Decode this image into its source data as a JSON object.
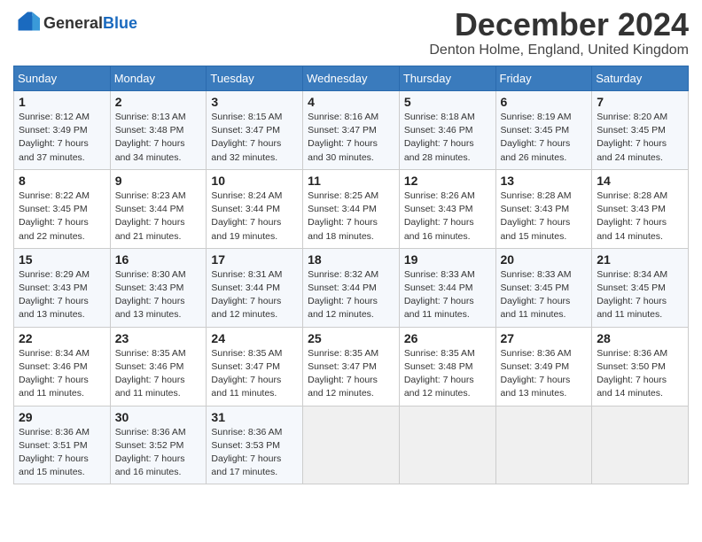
{
  "header": {
    "logo_line1": "General",
    "logo_line2": "Blue",
    "month_title": "December 2024",
    "location": "Denton Holme, England, United Kingdom"
  },
  "days_of_week": [
    "Sunday",
    "Monday",
    "Tuesday",
    "Wednesday",
    "Thursday",
    "Friday",
    "Saturday"
  ],
  "weeks": [
    [
      {
        "day": "1",
        "sunrise": "8:12 AM",
        "sunset": "3:49 PM",
        "daylight": "7 hours and 37 minutes."
      },
      {
        "day": "2",
        "sunrise": "8:13 AM",
        "sunset": "3:48 PM",
        "daylight": "7 hours and 34 minutes."
      },
      {
        "day": "3",
        "sunrise": "8:15 AM",
        "sunset": "3:47 PM",
        "daylight": "7 hours and 32 minutes."
      },
      {
        "day": "4",
        "sunrise": "8:16 AM",
        "sunset": "3:47 PM",
        "daylight": "7 hours and 30 minutes."
      },
      {
        "day": "5",
        "sunrise": "8:18 AM",
        "sunset": "3:46 PM",
        "daylight": "7 hours and 28 minutes."
      },
      {
        "day": "6",
        "sunrise": "8:19 AM",
        "sunset": "3:45 PM",
        "daylight": "7 hours and 26 minutes."
      },
      {
        "day": "7",
        "sunrise": "8:20 AM",
        "sunset": "3:45 PM",
        "daylight": "7 hours and 24 minutes."
      }
    ],
    [
      {
        "day": "8",
        "sunrise": "8:22 AM",
        "sunset": "3:45 PM",
        "daylight": "7 hours and 22 minutes."
      },
      {
        "day": "9",
        "sunrise": "8:23 AM",
        "sunset": "3:44 PM",
        "daylight": "7 hours and 21 minutes."
      },
      {
        "day": "10",
        "sunrise": "8:24 AM",
        "sunset": "3:44 PM",
        "daylight": "7 hours and 19 minutes."
      },
      {
        "day": "11",
        "sunrise": "8:25 AM",
        "sunset": "3:44 PM",
        "daylight": "7 hours and 18 minutes."
      },
      {
        "day": "12",
        "sunrise": "8:26 AM",
        "sunset": "3:43 PM",
        "daylight": "7 hours and 16 minutes."
      },
      {
        "day": "13",
        "sunrise": "8:28 AM",
        "sunset": "3:43 PM",
        "daylight": "7 hours and 15 minutes."
      },
      {
        "day": "14",
        "sunrise": "8:28 AM",
        "sunset": "3:43 PM",
        "daylight": "7 hours and 14 minutes."
      }
    ],
    [
      {
        "day": "15",
        "sunrise": "8:29 AM",
        "sunset": "3:43 PM",
        "daylight": "7 hours and 13 minutes."
      },
      {
        "day": "16",
        "sunrise": "8:30 AM",
        "sunset": "3:43 PM",
        "daylight": "7 hours and 13 minutes."
      },
      {
        "day": "17",
        "sunrise": "8:31 AM",
        "sunset": "3:44 PM",
        "daylight": "7 hours and 12 minutes."
      },
      {
        "day": "18",
        "sunrise": "8:32 AM",
        "sunset": "3:44 PM",
        "daylight": "7 hours and 12 minutes."
      },
      {
        "day": "19",
        "sunrise": "8:33 AM",
        "sunset": "3:44 PM",
        "daylight": "7 hours and 11 minutes."
      },
      {
        "day": "20",
        "sunrise": "8:33 AM",
        "sunset": "3:45 PM",
        "daylight": "7 hours and 11 minutes."
      },
      {
        "day": "21",
        "sunrise": "8:34 AM",
        "sunset": "3:45 PM",
        "daylight": "7 hours and 11 minutes."
      }
    ],
    [
      {
        "day": "22",
        "sunrise": "8:34 AM",
        "sunset": "3:46 PM",
        "daylight": "7 hours and 11 minutes."
      },
      {
        "day": "23",
        "sunrise": "8:35 AM",
        "sunset": "3:46 PM",
        "daylight": "7 hours and 11 minutes."
      },
      {
        "day": "24",
        "sunrise": "8:35 AM",
        "sunset": "3:47 PM",
        "daylight": "7 hours and 11 minutes."
      },
      {
        "day": "25",
        "sunrise": "8:35 AM",
        "sunset": "3:47 PM",
        "daylight": "7 hours and 12 minutes."
      },
      {
        "day": "26",
        "sunrise": "8:35 AM",
        "sunset": "3:48 PM",
        "daylight": "7 hours and 12 minutes."
      },
      {
        "day": "27",
        "sunrise": "8:36 AM",
        "sunset": "3:49 PM",
        "daylight": "7 hours and 13 minutes."
      },
      {
        "day": "28",
        "sunrise": "8:36 AM",
        "sunset": "3:50 PM",
        "daylight": "7 hours and 14 minutes."
      }
    ],
    [
      {
        "day": "29",
        "sunrise": "8:36 AM",
        "sunset": "3:51 PM",
        "daylight": "7 hours and 15 minutes."
      },
      {
        "day": "30",
        "sunrise": "8:36 AM",
        "sunset": "3:52 PM",
        "daylight": "7 hours and 16 minutes."
      },
      {
        "day": "31",
        "sunrise": "8:36 AM",
        "sunset": "3:53 PM",
        "daylight": "7 hours and 17 minutes."
      },
      null,
      null,
      null,
      null
    ]
  ]
}
